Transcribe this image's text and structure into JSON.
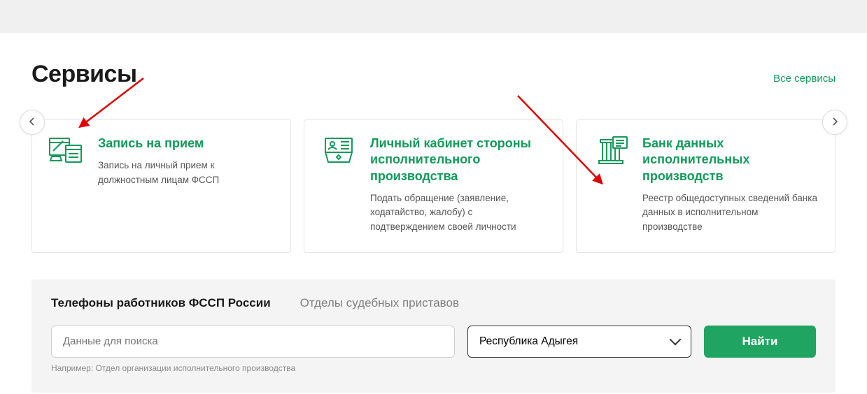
{
  "section_title": "Сервисы",
  "all_services_link": "Все сервисы",
  "cards": [
    {
      "title": "Запись на прием",
      "desc": "Запись на личный прием к должностным лицам ФССП"
    },
    {
      "title": "Личный кабинет стороны исполнительного производства",
      "desc": "Подать обращение (заявление, ходатайство, жалобу) с подтверждением своей личности"
    },
    {
      "title": "Банк данных исполнительных производств",
      "desc": "Реестр общедоступных сведений банка данных в исполнительном производстве"
    }
  ],
  "search": {
    "tab_phones": "Телефоны работников ФССП России",
    "tab_depts": "Отделы судебных приставов",
    "placeholder": "Данные для поиска",
    "region": "Республика Адыгея",
    "button": "Найти",
    "hint": "Например: Отдел организации исполнительного производства"
  }
}
